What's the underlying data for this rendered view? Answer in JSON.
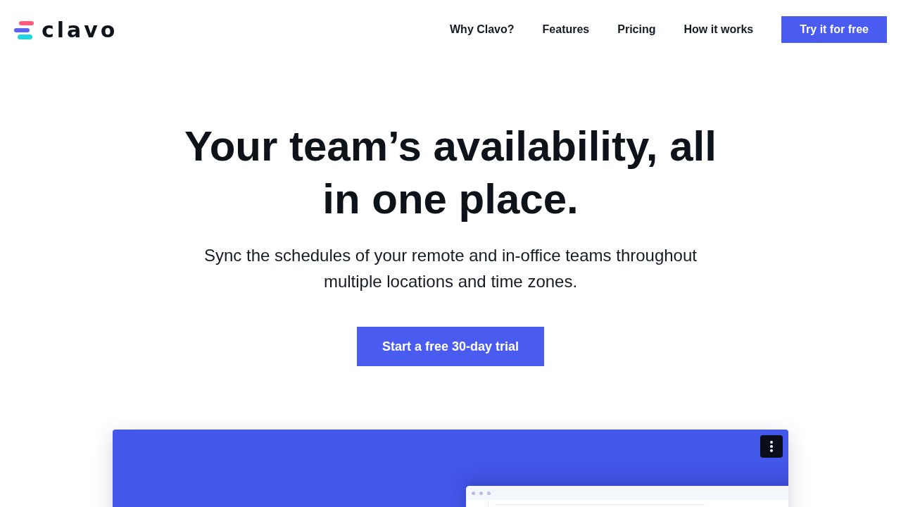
{
  "header": {
    "logo": {
      "wordmark": "clavo"
    },
    "nav": [
      {
        "label": "Why Clavo?"
      },
      {
        "label": "Features"
      },
      {
        "label": "Pricing"
      },
      {
        "label": "How it works"
      }
    ],
    "cta_button": "Try it for free"
  },
  "hero": {
    "title": "Your team’s availability, all in one place.",
    "subtitle": "Sync the schedules of your remote and in-office teams throughout multiple locations and time zones.",
    "cta_button": "Start a free 30-day trial"
  }
}
